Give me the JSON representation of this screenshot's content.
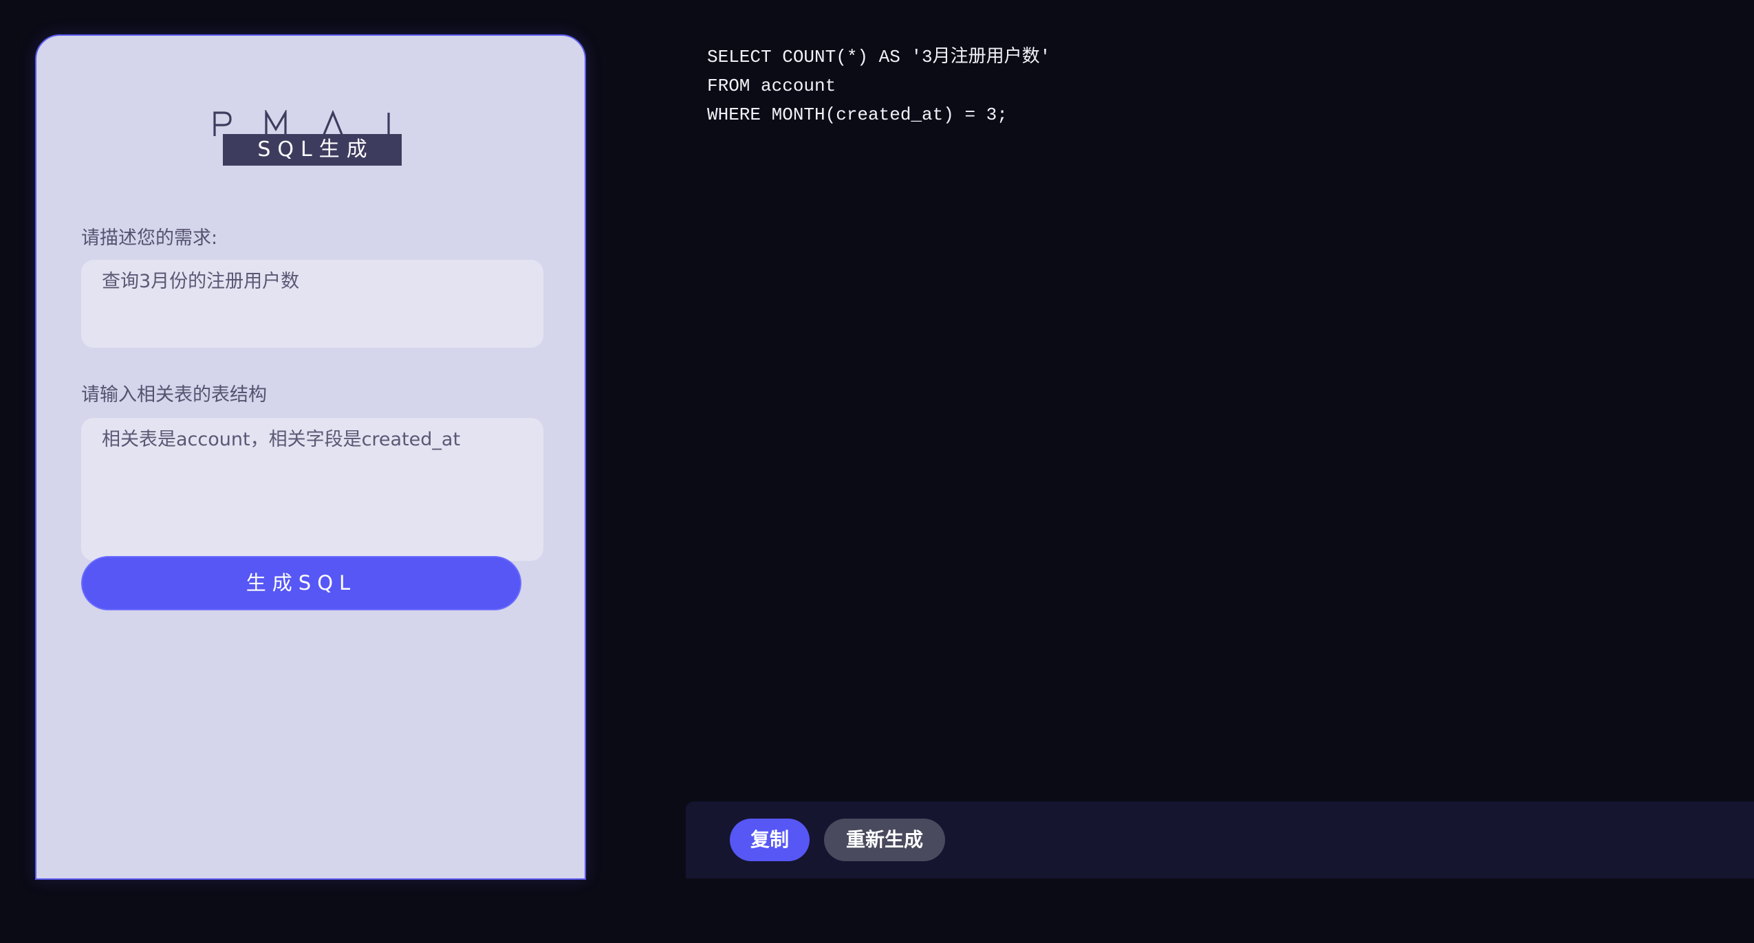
{
  "brand": {
    "logo_letters": [
      "P",
      "M",
      "A",
      "I"
    ],
    "badge_label": "SQL生成"
  },
  "form": {
    "requirement_label": "请描述您的需求:",
    "requirement_value": "查询3月份的注册用户数",
    "schema_label": "请输入相关表的表结构",
    "schema_value": "相关表是account，相关字段是created_at",
    "generate_button": "生成SQL"
  },
  "output": {
    "sql_lines": [
      "SELECT COUNT(*) AS '3月注册用户数'",
      "FROM account",
      "WHERE MONTH(created_at) = 3;"
    ]
  },
  "actions": {
    "copy_button": "复制",
    "regenerate_button": "重新生成"
  },
  "colors": {
    "background": "#0b0b16",
    "panel": "#d5d5eb",
    "accent": "#5657f5",
    "action_bar": "#151530"
  }
}
